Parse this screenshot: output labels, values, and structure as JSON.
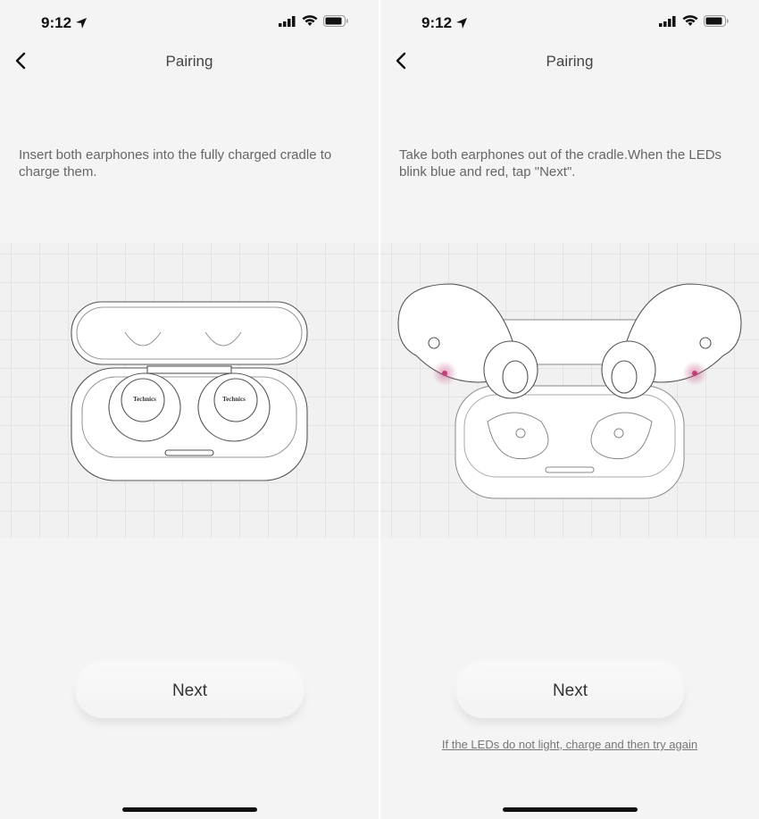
{
  "status_bar": {
    "time": "9:12",
    "icons": [
      "location-arrow-icon",
      "signal-icon",
      "wifi-icon",
      "battery-icon"
    ]
  },
  "screens": [
    {
      "title": "Pairing",
      "instruction": "Insert both earphones into the fully charged cradle to charge them.",
      "next_label": "Next",
      "brand_label": "Technics"
    },
    {
      "title": "Pairing",
      "instruction": "Take both earphones out of the cradle.When the LEDs blink blue and red, tap \"Next\".",
      "next_label": "Next",
      "help_link": "If the LEDs do not light, charge and then try again",
      "led_color": "#c0407a"
    }
  ]
}
